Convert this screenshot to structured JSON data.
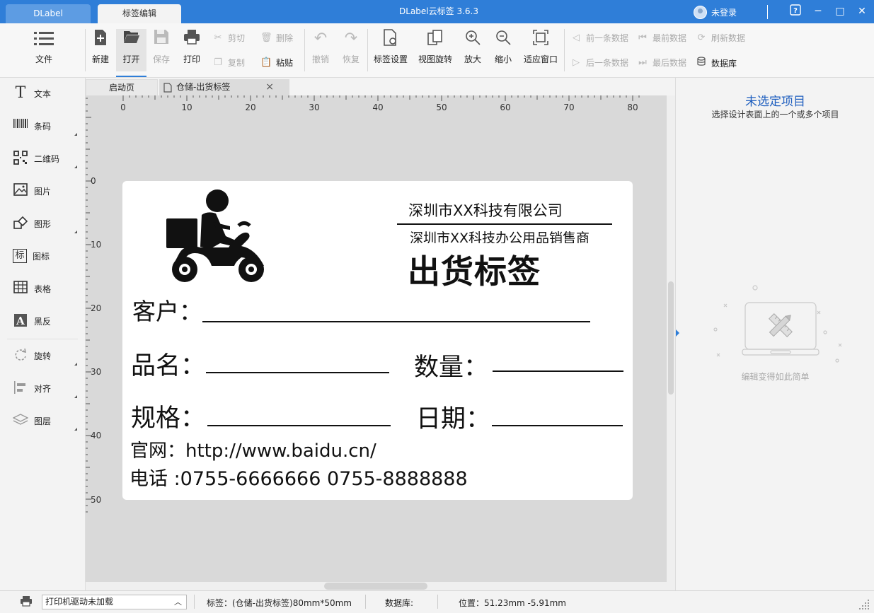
{
  "titlebar": {
    "tabs": [
      "DLabel",
      "标签编辑"
    ],
    "app_title": "DLabel云标签 3.6.3",
    "user": "未登录",
    "help_icon": "?",
    "minimize": "─",
    "maximize": "□",
    "close": "✕"
  },
  "toolbar": {
    "file": "文件",
    "new": "新建",
    "open": "打开",
    "save": "保存",
    "print": "打印",
    "cut": "剪切",
    "delete": "删除",
    "copy": "复制",
    "paste": "粘贴",
    "undo": "撤销",
    "redo": "恢复",
    "label_settings": "标签设置",
    "view_rotate": "视图旋转",
    "zoom_in": "放大",
    "zoom_out": "缩小",
    "fit_window": "适应窗口",
    "prev_record": "前一条数据",
    "first_record": "最前数据",
    "refresh_data": "刷新数据",
    "next_record": "后一条数据",
    "last_record": "最后数据",
    "database": "数据库"
  },
  "left_panel": {
    "items": [
      "文本",
      "条码",
      "二维码",
      "图片",
      "图形",
      "图标",
      "表格",
      "黑反",
      "旋转",
      "对齐",
      "图层"
    ]
  },
  "doc_tabs": [
    "启动页",
    "仓储-出货标签"
  ],
  "ruler": {
    "h_ticks": [
      "0",
      "10",
      "20",
      "30",
      "40",
      "50",
      "60",
      "70",
      "80"
    ],
    "v_ticks": [
      "0",
      "10",
      "20",
      "30",
      "40",
      "50"
    ]
  },
  "label": {
    "company": "深圳市XX科技有限公司",
    "subtitle": "深圳市XX科技办公用品销售商",
    "heading": "出货标签",
    "customer": "客户：",
    "product": "品名：",
    "quantity": "数量：",
    "spec": "规格：",
    "date": "日期：",
    "website": "官网：http://www.baidu.cn/",
    "phone": "电话 :0755-6666666   0755-8888888"
  },
  "right_panel": {
    "title": "未选定项目",
    "subtitle": "选择设计表面上的一个或多个项目",
    "hint": "编辑变得如此简单"
  },
  "status_bar": {
    "printer_driver": "打印机驱动未加载",
    "label_info": "标签：(仓储-出货标签)80mm*50mm",
    "database": "数据库:",
    "position": "位置：51.23mm -5.91mm"
  },
  "colors": {
    "accent": "#2f7ed8",
    "title_link": "#1f5fbf"
  }
}
